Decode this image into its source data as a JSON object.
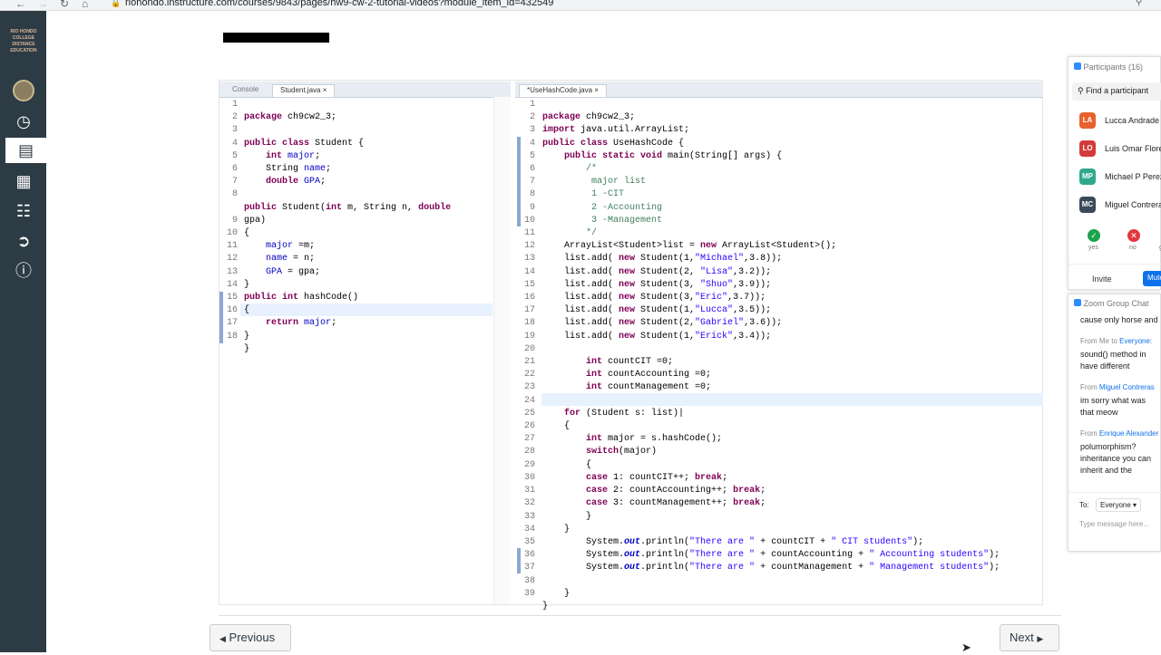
{
  "browser": {
    "url": "riohondo.instructure.com/courses/9843/pages/hw9-cw-2-tutorial-videos?module_item_id=432549"
  },
  "leftnav": {
    "logo_text": "RIO HONDO COLLEGE DISTANCE EDUCATION",
    "icons": [
      "avatar-icon",
      "dashboard-icon",
      "courses-icon",
      "calendar-icon",
      "inbox-icon",
      "commons-icon",
      "help-icon"
    ]
  },
  "ide": {
    "left_tabs": {
      "console": "Console",
      "file": "Student.java"
    },
    "right_tab": "*UseHashCode.java",
    "left_line_numbers": [
      "1",
      "2",
      "3",
      "4",
      "5",
      "6",
      "7",
      "8",
      "",
      "9",
      "10",
      "11",
      "12",
      "13",
      "14",
      "15",
      "16",
      "17",
      "18"
    ],
    "left_code_plain": [
      "package ch9cw2_3;",
      "",
      "public class Student {",
      "    int major;",
      "    String name;",
      "    double GPA;",
      "",
      "public Student(int m, String n, double",
      "gpa)",
      "{",
      "    major =m;",
      "    name = n;",
      "    GPA = gpa;",
      "}",
      "public int hashCode()",
      "{",
      "    return major;",
      "}",
      "}"
    ],
    "right_line_numbers": [
      "1",
      "2",
      "3",
      "4",
      "5",
      "6",
      "7",
      "8",
      "9",
      "10",
      "11",
      "12",
      "13",
      "14",
      "15",
      "16",
      "17",
      "18",
      "19",
      "20",
      "21",
      "22",
      "23",
      "24",
      "25",
      "26",
      "27",
      "28",
      "29",
      "30",
      "31",
      "32",
      "33",
      "34",
      "35",
      "36",
      "37",
      "38",
      "39"
    ],
    "right_code_plain": [
      "package ch9cw2_3;",
      "import java.util.ArrayList;",
      "public class UseHashCode {",
      "    public static void main(String[] args) {",
      "        /*",
      "         major list",
      "         1 -CIT",
      "         2 -Accounting",
      "         3 -Management",
      "        */",
      "    ArrayList<Student>list = new ArrayList<Student>();",
      "    list.add( new Student(1,\"Michael\",3.8));",
      "    list.add( new Student(2, \"Lisa\",3.2));",
      "    list.add( new Student(3, \"Shuo\",3.9));",
      "    list.add( new Student(3,\"Eric\",3.7));",
      "    list.add( new Student(1,\"Lucca\",3.5));",
      "    list.add( new Student(2,\"Gabriel\",3.6));",
      "    list.add( new Student(1,\"Erick\",3.4));",
      "",
      "        int countCIT =0;",
      "        int countAccounting =0;",
      "        int countManagement =0;",
      "",
      "    for (Student s: list)",
      "    {",
      "        int major = s.hashCode();",
      "        switch(major)",
      "        {",
      "        case 1: countCIT++; break;",
      "        case 2: countAccounting++; break;",
      "        case 3: countManagement++; break;",
      "        }",
      "    }",
      "        System.out.println(\"There are \" + countCIT + \" CIT students\");",
      "        System.out.println(\"There are \" + countAccounting + \" Accounting students\");",
      "        System.out.println(\"There are \" + countManagement + \" Management students\");",
      "",
      "    }",
      "}"
    ]
  },
  "zoom": {
    "participants_title": "Participants (16)",
    "search_placeholder": "Find a participant",
    "participants": [
      {
        "initials": "LA",
        "name": "Lucca Andrade",
        "color": "#e8612c"
      },
      {
        "initials": "LO",
        "name": "Luis Omar Flores",
        "color": "#d33a3a"
      },
      {
        "initials": "MP",
        "name": "Michael P Perez",
        "color": "#2fa88c"
      },
      {
        "initials": "MC",
        "name": "Miguel Contreras",
        "color": "#3b4a5a"
      }
    ],
    "reactions": [
      {
        "label": "yes",
        "color": "#1aa34a"
      },
      {
        "label": "no",
        "color": "#e2373f"
      },
      {
        "label": "go",
        "color": "#999999"
      }
    ],
    "invite_label": "Invite",
    "mute_label": "Mute All",
    "chat_title": "Zoom Group Chat",
    "chat_messages": [
      {
        "from": "",
        "to": "",
        "text": "cause only horse and"
      },
      {
        "from": "From Me to ",
        "to": "Everyone:",
        "text": "sound() method in have different functions"
      },
      {
        "from": "From ",
        "to": "Miguel Contreras",
        "text": "im sorry what was that meow"
      },
      {
        "from": "From ",
        "to": "Enrique Alexander",
        "text": "polumorphism? inheritance you can inherit and the subclass"
      }
    ],
    "to_label": "To:",
    "to_value": "Everyone",
    "message_placeholder": "Type message here..."
  },
  "footer": {
    "previous_label": "Previous",
    "next_label": "Next"
  }
}
